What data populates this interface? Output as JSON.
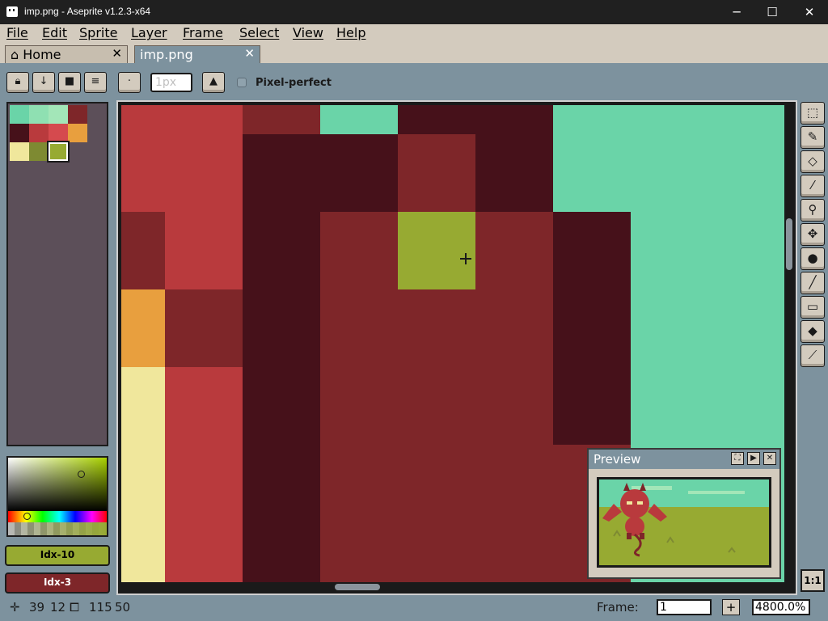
{
  "window": {
    "title": "imp.png - Aseprite v1.2.3-x64",
    "minimize": "─",
    "maximize": "☐",
    "close": "✕"
  },
  "menu": [
    "File",
    "Edit",
    "Sprite",
    "Layer",
    "Frame",
    "Select",
    "View",
    "Help"
  ],
  "tabs": [
    {
      "label": "Home",
      "close": "✕",
      "icon": "home-icon"
    },
    {
      "label": "imp.png",
      "close": "✕"
    }
  ],
  "toolbar": {
    "brush_size": "1px",
    "pixel_perfect_label": "Pixel-perfect",
    "pixel_perfect_checked": false,
    "buttons": [
      "lock-icon",
      "down-arrow-icon",
      "square-icon",
      "menu-icon",
      "dot-icon",
      "ink-icon"
    ]
  },
  "palette": {
    "colors": [
      "#6ad4a8",
      "#8fe0b2",
      "#a3e6b8",
      "#7e2629",
      "#46111a",
      "#b93a3d",
      "#d54a4e",
      "#e89f3e",
      "#f0e79c",
      "#7e8a32",
      "#97aa32"
    ],
    "selected_index": 10
  },
  "foreground": {
    "label": "Idx-10",
    "color": "#97aa32"
  },
  "background": {
    "label": "Idx-3",
    "color": "#7e2629"
  },
  "preview": {
    "title": "Preview"
  },
  "status": {
    "cursor_x": "39",
    "cursor_y": "12",
    "sprite_w": "115",
    "sprite_h": "50",
    "frame_label": "Frame:",
    "frame_value": "1",
    "plus": "+",
    "zoom": "4800.0%",
    "zoom_reset": "1:1"
  },
  "tools": [
    "marquee-icon",
    "pencil-icon",
    "eraser-icon",
    "eyedropper-icon",
    "zoom-icon",
    "move-icon",
    "fill-icon",
    "line-icon",
    "rectangle-icon",
    "contour-icon",
    "blur-icon"
  ]
}
